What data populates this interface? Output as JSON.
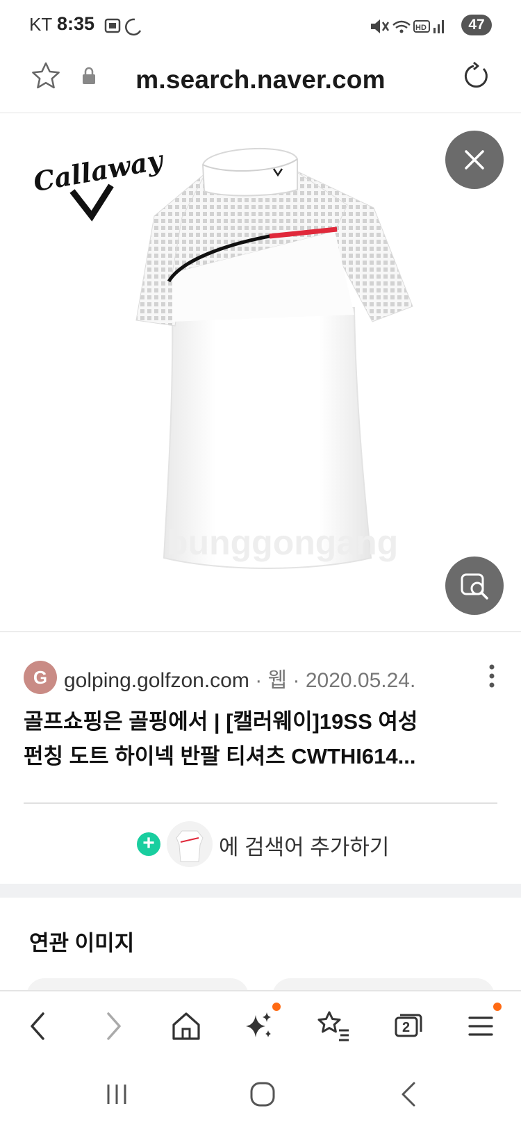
{
  "status_bar": {
    "carrier": "KT",
    "time": "8:35",
    "battery": "47"
  },
  "browser": {
    "url": "m.search.naver.com"
  },
  "image": {
    "brand_logo": "Callaway",
    "watermark": "bunggongang"
  },
  "result": {
    "favicon_letter": "G",
    "source": "golping.golfzon.com",
    "separator": "·",
    "type": "웹",
    "date": "2020.05.24.",
    "title_line1": "골프쇼핑은 골핑에서 | [캘러웨이]19SS 여성",
    "title_line2": "펀칭 도트 하이넥 반팔 티셔츠 CWTHI614..."
  },
  "add_query": {
    "label": "에 검색어 추가하기"
  },
  "related": {
    "title": "연관 이미지"
  },
  "toolbar": {
    "tabs_count": "2"
  },
  "colors": {
    "accent_green": "#19ce9f",
    "notification_dot": "#ff6a13",
    "stripe_red": "#e0283a"
  }
}
